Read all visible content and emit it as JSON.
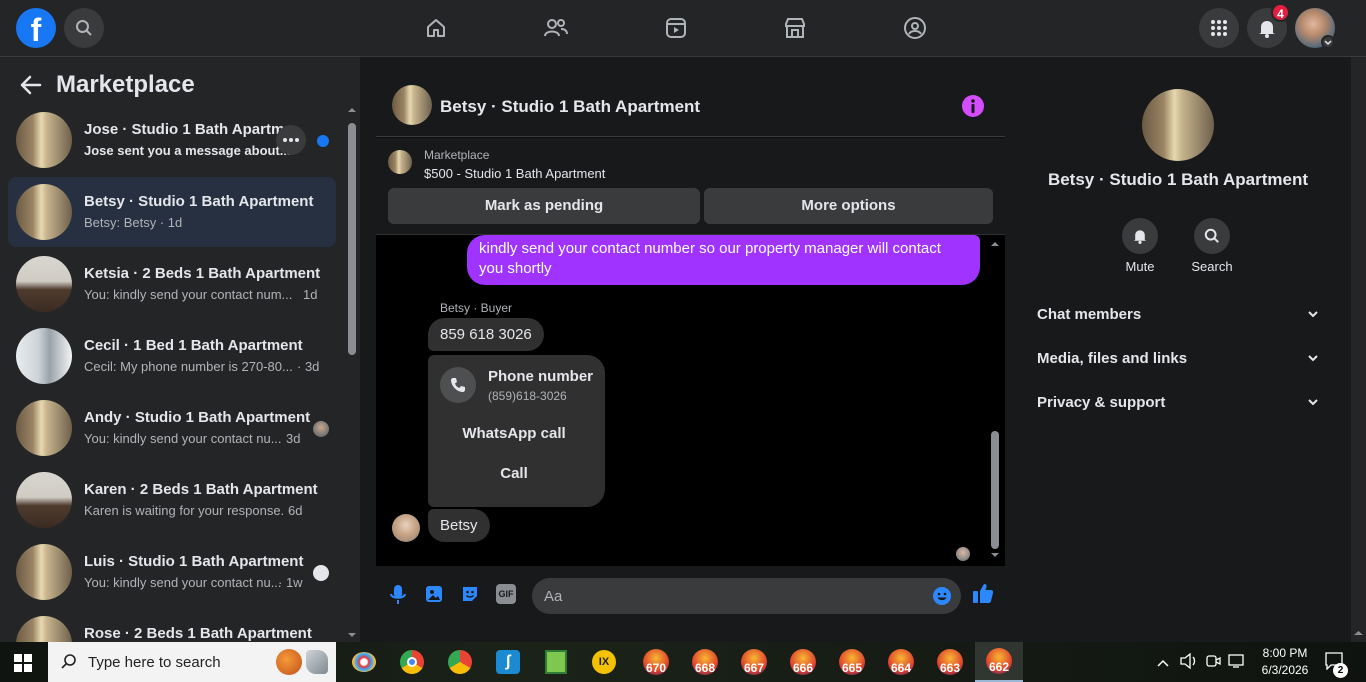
{
  "topbar": {
    "logo_letter": "f",
    "notifications_badge": "4"
  },
  "sidebar": {
    "title": "Marketplace",
    "conversations": [
      {
        "name": "Jose · Studio 1 Bath Apartme",
        "preview": "Jose sent you a message about...",
        "time": "",
        "unread": true
      },
      {
        "name": "Betsy · Studio 1 Bath Apartment",
        "preview": "Betsy: Betsy · 1d",
        "time": "",
        "active": true
      },
      {
        "name": "Ketsia · 2 Beds 1 Bath Apartment",
        "preview": "You: kindly send your contact num...",
        "time": "1d"
      },
      {
        "name": "Cecil · 1 Bed 1 Bath Apartment",
        "preview": "Cecil: My phone number is 270-80...",
        "time": "· 3d"
      },
      {
        "name": "Andy · Studio 1 Bath Apartment",
        "preview": "You: kindly send your contact nu...",
        "time": "3d"
      },
      {
        "name": "Karen · 2 Beds 1 Bath Apartment",
        "preview": "Karen is waiting for your response. ·",
        "time": "6d"
      },
      {
        "name": "Luis · Studio 1 Bath Apartment",
        "preview": "You: kindly send your contact nu...",
        "time": "· 1w"
      },
      {
        "name": "Rose · 2 Beds 1 Bath Apartment",
        "preview": "",
        "time": ""
      }
    ]
  },
  "chat": {
    "title": "Betsy · Studio 1 Bath Apartment",
    "listing_source": "Marketplace",
    "listing_title": "$500 - Studio 1 Bath Apartment",
    "mark_pending_label": "Mark as pending",
    "more_options_label": "More options",
    "outgoing_message": "kindly send your contact number so our property manager will contact you shortly",
    "sender_label": "Betsy · Buyer",
    "incoming_number": "859 618 3026",
    "phone_card_title": "Phone number",
    "phone_card_number": "(859)618-3026",
    "whatsapp_label": "WhatsApp call",
    "call_label": "Call",
    "last_incoming": "Betsy",
    "composer_placeholder": "Aa"
  },
  "details": {
    "title": "Betsy · Studio 1 Bath Apartment",
    "mute_label": "Mute",
    "search_label": "Search",
    "sections": [
      "Chat members",
      "Media, files and links",
      "Privacy & support"
    ]
  },
  "taskbar": {
    "search_placeholder": "Type here to search",
    "apps": [
      "670",
      "668",
      "667",
      "666",
      "665",
      "664",
      "663",
      "662"
    ],
    "time": "8:00 PM",
    "date": "6/3/2026",
    "notification_count": "2"
  },
  "colors": {
    "accent": "#1877f2",
    "bubble_out": "#a033ff",
    "info_icon": "#d34dff",
    "notification": "#e41e3f"
  }
}
